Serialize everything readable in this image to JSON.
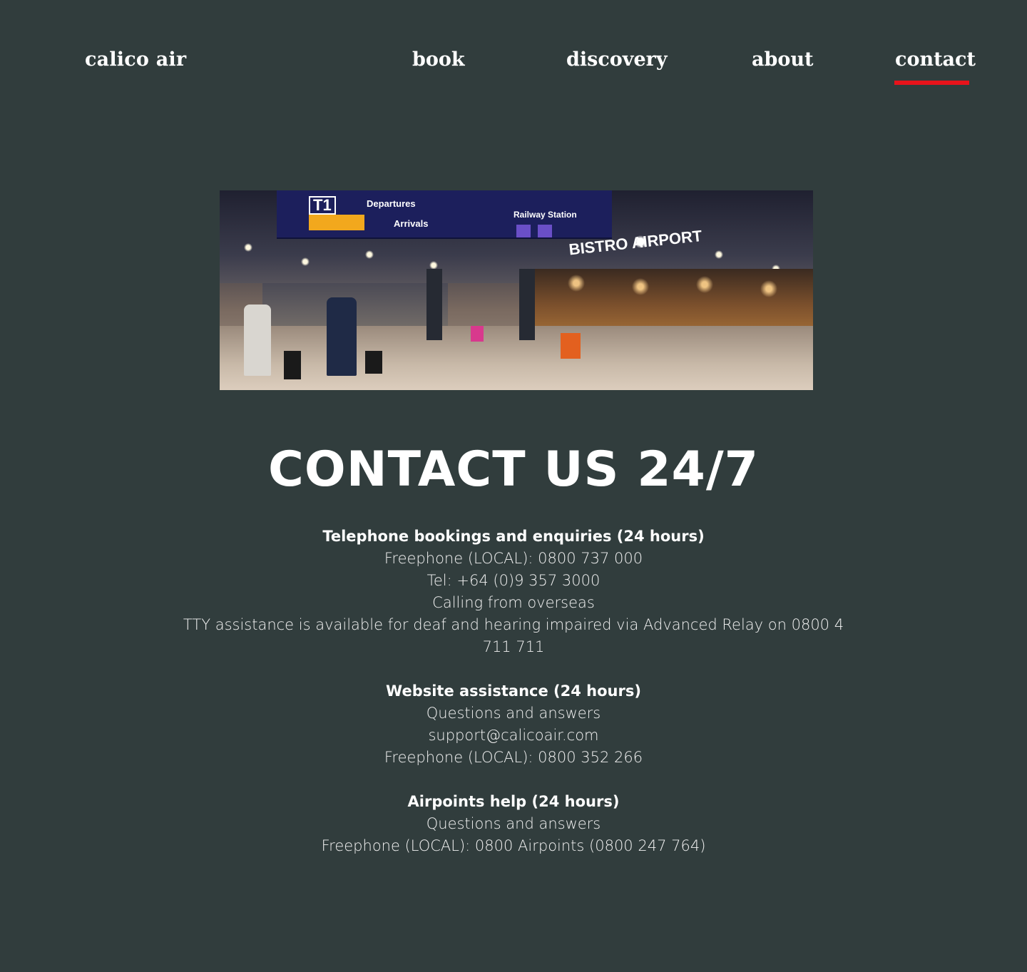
{
  "header": {
    "brand": "calico air",
    "nav": [
      {
        "label": "book",
        "active": false
      },
      {
        "label": "discovery",
        "active": false
      },
      {
        "label": "about",
        "active": false
      },
      {
        "label": "contact",
        "active": true
      }
    ],
    "active_indicator_color": "#e8131b"
  },
  "hero_image": {
    "sign_t1": "T1",
    "sign_departures": "Departures",
    "sign_arrivals": "Arrivals",
    "sign_railway": "Railway Station",
    "sign_bistro": "BISTRO AIRPORT"
  },
  "main": {
    "title": "CONTACT US 24/7",
    "sections": [
      {
        "heading": "Telephone bookings and enquiries (24 hours)",
        "lines": [
          "Freephone (LOCAL): 0800 737 000",
          "Tel: +64 (0)9 357 3000",
          "Calling from overseas",
          "TTY assistance is available for deaf and hearing impaired via Advanced Relay on 0800 4 711 711"
        ]
      },
      {
        "heading": "Website assistance (24 hours)",
        "lines": [
          "Questions and answers",
          "support@calicoair.com",
          "Freephone (LOCAL): 0800 352 266"
        ]
      },
      {
        "heading": "Airpoints help (24 hours)",
        "lines": [
          "Questions and answers",
          "Freephone (LOCAL): 0800 Airpoints (0800 247 764)"
        ]
      }
    ]
  },
  "colors": {
    "background": "#313d3d",
    "text": "#ffffff",
    "accent": "#e8131b"
  }
}
